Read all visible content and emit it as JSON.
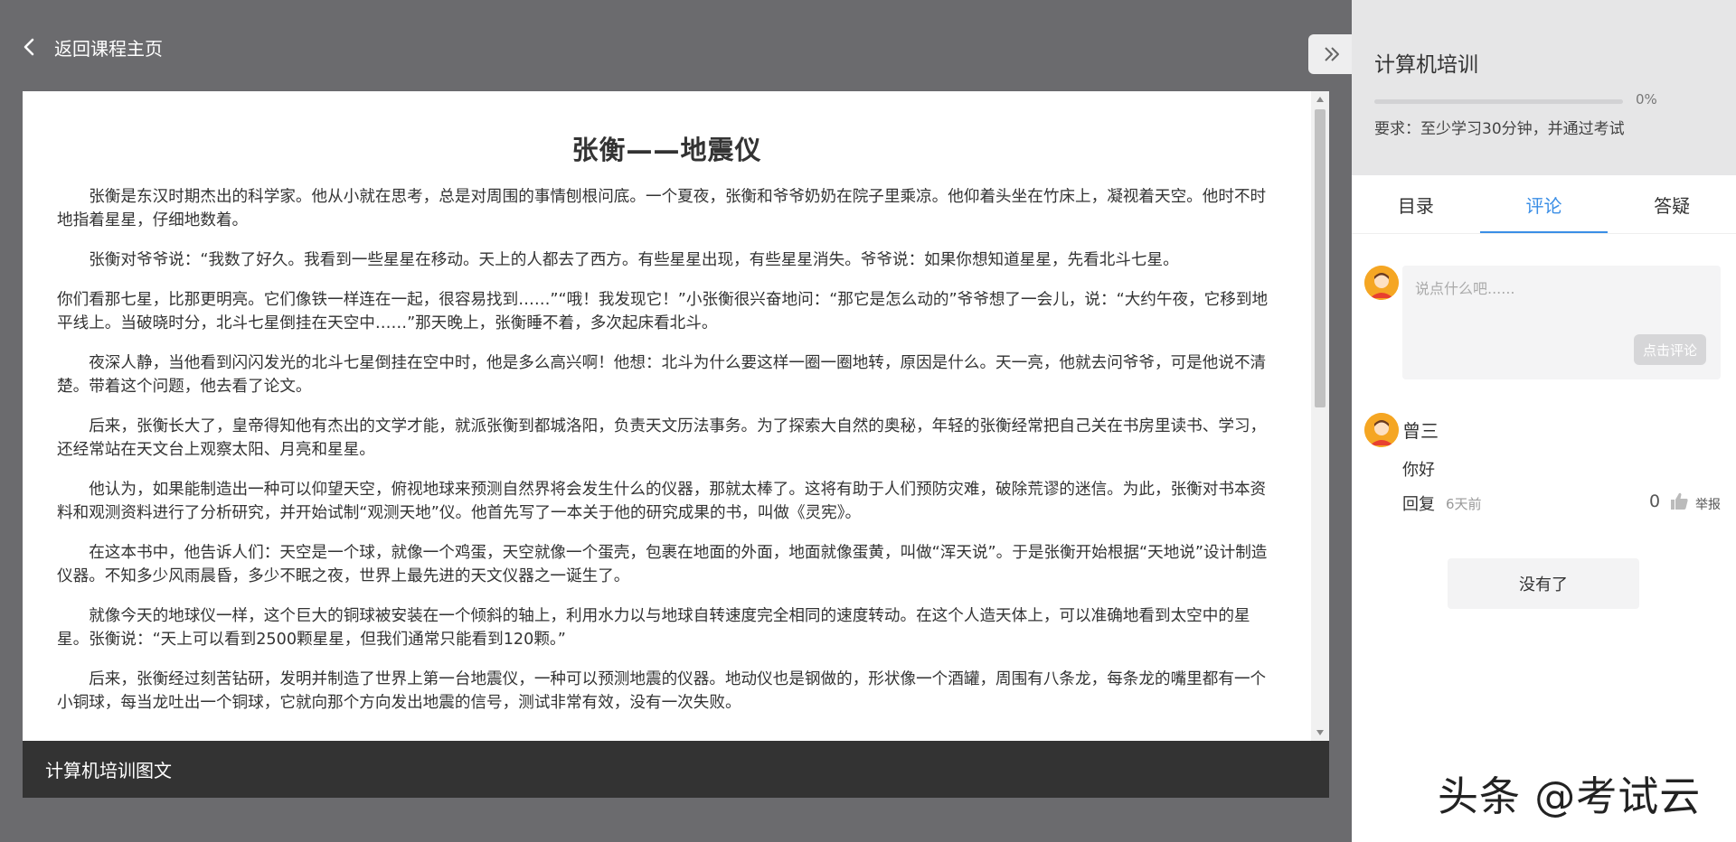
{
  "nav": {
    "back_label": "返回课程主页"
  },
  "document": {
    "title": "张衡——地震仪",
    "paragraphs": [
      "张衡是东汉时期杰出的科学家。他从小就在思考，总是对周围的事情刨根问底。一个夏夜，张衡和爷爷奶奶在院子里乘凉。他仰着头坐在竹床上，凝视着天空。他时不时地指着星星，仔细地数着。",
      "张衡对爷爷说：“我数了好久。我看到一些星星在移动。天上的人都去了西方。有些星星出现，有些星星消失。爷爷说：如果你想知道星星，先看北斗七星。",
      "你们看那七星，比那更明亮。它们像铁一样连在一起，很容易找到……”“哦！我发现它！”小张衡很兴奋地问：“那它是怎么动的”爷爷想了一会儿，说：“大约午夜，它移到地平线上。当破晓时分，北斗七星倒挂在天空中……”那天晚上，张衡睡不着，多次起床看北斗。",
      "夜深人静，当他看到闪闪发光的北斗七星倒挂在空中时，他是多么高兴啊！他想：北斗为什么要这样一圈一圈地转，原因是什么。天一亮，他就去问爷爷，可是他说不清楚。带着这个问题，他去看了论文。",
      "后来，张衡长大了，皇帝得知他有杰出的文学才能，就派张衡到都城洛阳，负责天文历法事务。为了探索大自然的奥秘，年轻的张衡经常把自己关在书房里读书、学习，还经常站在天文台上观察太阳、月亮和星星。",
      "他认为，如果能制造出一种可以仰望天空，俯视地球来预测自然界将会发生什么的仪器，那就太棒了。这将有助于人们预防灾难，破除荒谬的迷信。为此，张衡对书本资料和观测资料进行了分析研究，并开始试制“观测天地”仪。他首先写了一本关于他的研究成果的书，叫做《灵宪》。",
      "在这本书中，他告诉人们：天空是一个球，就像一个鸡蛋，天空就像一个蛋壳，包裹在地面的外面，地面就像蛋黄，叫做“浑天说”。于是张衡开始根据“天地说”设计制造仪器。不知多少风雨晨昏，多少不眠之夜，世界上最先进的天文仪器之一诞生了。",
      "就像今天的地球仪一样，这个巨大的铜球被安装在一个倾斜的轴上，利用水力以与地球自转速度完全相同的速度转动。在这个人造天体上，可以准确地看到太空中的星星。张衡说：“天上可以看到2500颗星星，但我们通常只能看到120颗。”",
      "后来，张衡经过刻苦钻研，发明并制造了世界上第一台地震仪，一种可以预测地震的仪器。地动仪也是钢做的，形状像一个酒罐，周围有八条龙，每条龙的嘴里都有一个小铜球，每当龙吐出一个铜球，它就向那个方向发出地震的信号，测试非常有效，没有一次失败。"
    ],
    "footer_title": "计算机培训图文"
  },
  "course": {
    "title": "计算机培训",
    "progress_value": 0,
    "progress_text": "0%",
    "requirement": "要求：至少学习30分钟，并通过考试",
    "accent_color": "#3a8ee6"
  },
  "tabs": [
    {
      "label": "目录",
      "active": false
    },
    {
      "label": "评论",
      "active": true
    },
    {
      "label": "答疑",
      "active": false
    }
  ],
  "comment_form": {
    "placeholder": "说点什么吧......",
    "submit_label": "点击评论"
  },
  "comments": [
    {
      "author": "曾三",
      "text": "你好",
      "reply_label": "回复",
      "time": "6天前",
      "likes": "0",
      "report_label": "举报"
    }
  ],
  "no_more_label": "没有了",
  "watermark": "头条 @考试云",
  "icons": {
    "back": "chevron-left-icon",
    "collapse": "double-chevron-right-icon",
    "like": "thumbs-up-icon"
  }
}
